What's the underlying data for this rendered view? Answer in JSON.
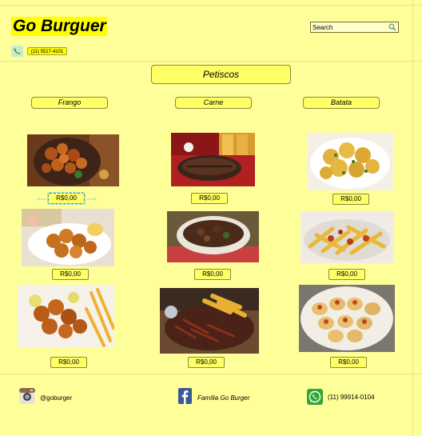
{
  "header": {
    "brand": "Go Burguer",
    "phone": "(11) 5527-4101",
    "search": {
      "placeholder": "Search"
    }
  },
  "category": {
    "title": "Petiscos"
  },
  "filters": [
    "Frango",
    "Carne",
    "Batata"
  ],
  "menu": {
    "items": [
      {
        "image": "fried-chicken-plate",
        "price": "R$0,00"
      },
      {
        "image": "grilled-beef-board",
        "price": "R$0,00"
      },
      {
        "image": "seasoned-potatoes",
        "price": "R$0,00"
      },
      {
        "image": "chicken-bites-plate",
        "price": "R$0,00"
      },
      {
        "image": "beef-stew-bowl",
        "price": "R$0,00"
      },
      {
        "image": "cheese-bacon-fries",
        "price": "R$0,00"
      },
      {
        "image": "chicken-and-fries",
        "price": "R$0,00"
      },
      {
        "image": "beef-and-fries-platter",
        "price": "R$0,00"
      },
      {
        "image": "stuffed-potato-halves",
        "price": "R$0,00"
      }
    ]
  },
  "footer": {
    "instagram": "@goburger",
    "facebook": "Família Go Burger",
    "whatsapp": "(11) 99914-0104"
  },
  "colors": {
    "background": "#ffff99",
    "accent": "#ffff00",
    "button": "#ffff66",
    "whatsapp": "#2fa833",
    "facebook": "#3b5998"
  },
  "icons": [
    "phone-icon",
    "search-icon",
    "instagram-icon",
    "facebook-icon",
    "whatsapp-icon"
  ]
}
